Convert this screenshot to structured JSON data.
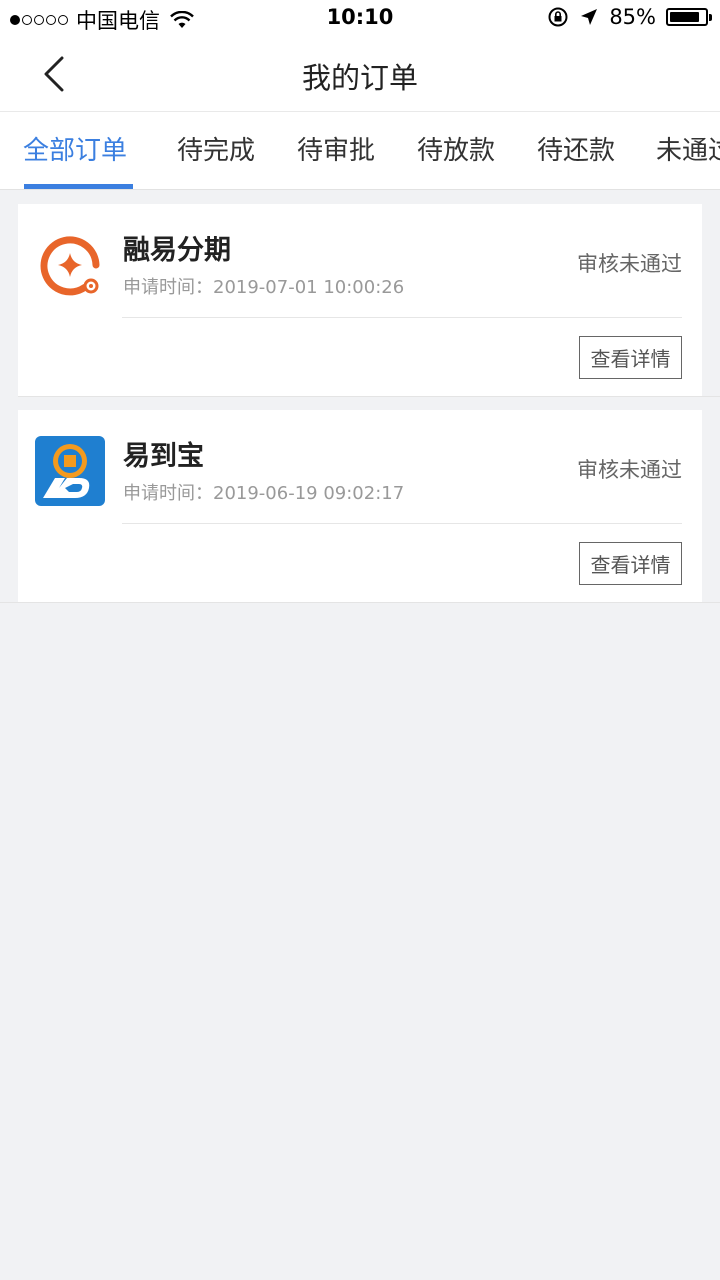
{
  "status_bar": {
    "carrier": "中国电信",
    "time": "10:10",
    "battery": "85%",
    "battery_level": 0.85
  },
  "nav": {
    "title": "我的订单"
  },
  "tabs": [
    {
      "label": "全部订单",
      "active": true
    },
    {
      "label": "待完成"
    },
    {
      "label": "待审批"
    },
    {
      "label": "待放款"
    },
    {
      "label": "待还款"
    },
    {
      "label": "未通过"
    }
  ],
  "orders": [
    {
      "name": "融易分期",
      "apply_time": "申请时间：2019-07-01 10:00:26",
      "status": "审核未通过",
      "button": "查看详情",
      "logo": "coin-ring-icon"
    },
    {
      "name": "易到宝",
      "apply_time": "申请时间：2019-06-19 09:02:17",
      "status": "审核未通过",
      "button": "查看详情",
      "logo": "coin-blue-app-icon"
    }
  ],
  "colors": {
    "accent": "#3b7fe0",
    "logo_orange": "#e8652a",
    "logo_blue": "#1f7fd0",
    "background": "#f1f2f4"
  }
}
